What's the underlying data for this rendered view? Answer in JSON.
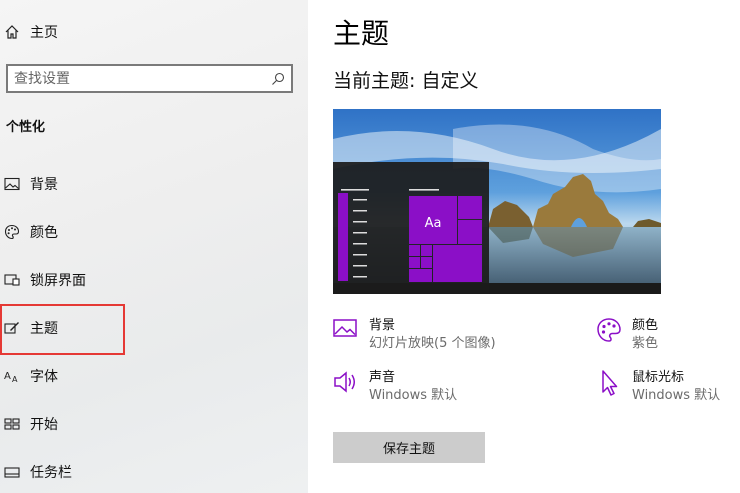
{
  "sidebar": {
    "home_label": "主页",
    "search_placeholder": "查找设置",
    "section_title": "个性化",
    "items": [
      {
        "label": "背景"
      },
      {
        "label": "颜色"
      },
      {
        "label": "锁屏界面"
      },
      {
        "label": "主题"
      },
      {
        "label": "字体"
      },
      {
        "label": "开始"
      },
      {
        "label": "任务栏"
      }
    ]
  },
  "main": {
    "title": "主题",
    "current_theme": "当前主题: 自定义",
    "preview": {
      "tile_text": "Aa"
    },
    "properties": [
      {
        "title": "背景",
        "value": "幻灯片放映(5 个图像)",
        "icon": "picture-icon"
      },
      {
        "title": "颜色",
        "value": "紫色",
        "icon": "palette-icon"
      },
      {
        "title": "声音",
        "value": "Windows 默认",
        "icon": "speaker-icon"
      },
      {
        "title": "鼠标光标",
        "value": "Windows 默认",
        "icon": "cursor-icon"
      }
    ],
    "save_label": "保存主题"
  },
  "colors": {
    "accent": "#8b0fc7",
    "highlight_border": "#e53935"
  }
}
